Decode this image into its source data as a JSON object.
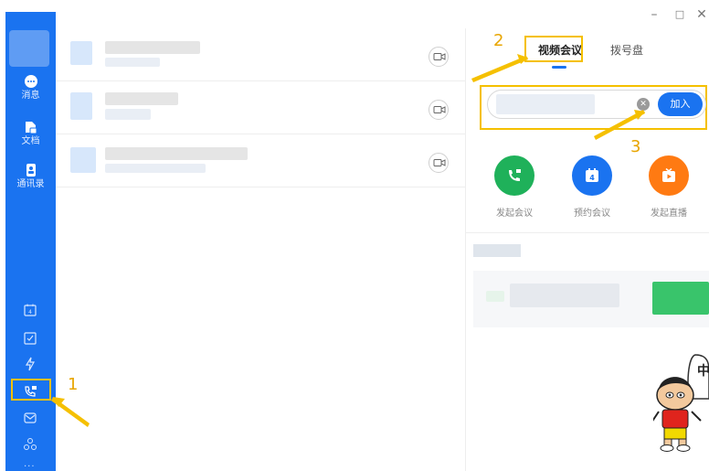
{
  "window": {
    "minimize_glyph": "–",
    "maximize_glyph": "□",
    "close_glyph": "✕"
  },
  "sidebar": {
    "items": [
      {
        "label": "消息",
        "icon": "chat-bubble-icon"
      },
      {
        "label": "文档",
        "icon": "document-icon"
      },
      {
        "label": "通讯录",
        "icon": "contacts-icon"
      }
    ],
    "tools": [
      "calendar-icon",
      "todo-check-icon",
      "lightning-icon",
      "meeting-phone-icon",
      "mail-icon",
      "apps-icon"
    ],
    "more_glyph": "···"
  },
  "tabs": {
    "video_meeting": "视频会议",
    "dial_pad": "拨号盘"
  },
  "join": {
    "clear_glyph": "✕",
    "button_label": "加入"
  },
  "actions": [
    {
      "label": "发起会议",
      "color": "#1fb15a",
      "icon": "phone-plus-icon"
    },
    {
      "label": "预约会议",
      "color": "#1a73f0",
      "icon": "calendar-icon"
    },
    {
      "label": "发起直播",
      "color": "#ff7a12",
      "icon": "live-play-icon"
    }
  ],
  "annotations": {
    "step1": "1",
    "step2": "2",
    "step3": "3",
    "highlight_color": "#f5c000"
  },
  "cartoon": {
    "bubble_text": "中"
  },
  "colors": {
    "accent": "#1a73f0",
    "sidebar": "#1a73f0"
  }
}
